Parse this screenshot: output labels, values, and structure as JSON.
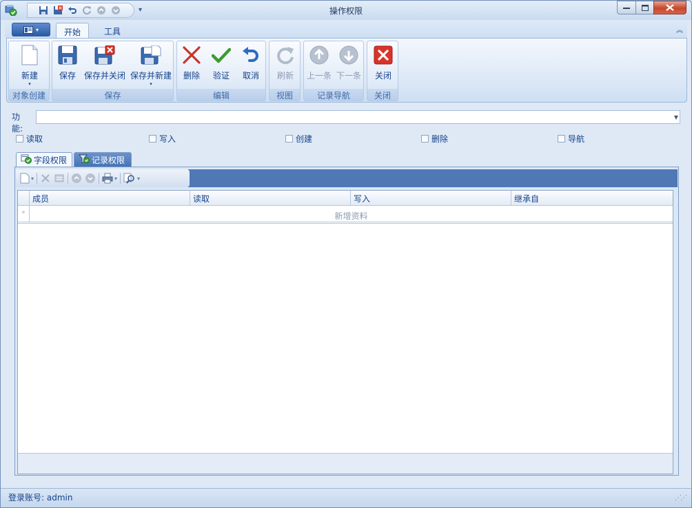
{
  "window": {
    "title": "操作权限"
  },
  "ribbon": {
    "tabs": [
      {
        "label": "开始",
        "active": true
      },
      {
        "label": "工具",
        "active": false
      }
    ],
    "groups": {
      "create": {
        "label": "对象创建",
        "new_label": "新建"
      },
      "save": {
        "label": "保存",
        "save_label": "保存",
        "save_close_label": "保存并关闭",
        "save_new_label": "保存并新建"
      },
      "edit": {
        "label": "编辑",
        "delete_label": "删除",
        "validate_label": "验证",
        "cancel_label": "取消"
      },
      "view": {
        "label": "视图",
        "refresh_label": "刷新"
      },
      "nav": {
        "label": "记录导航",
        "prev_label": "上一条",
        "next_label": "下一条"
      },
      "close": {
        "label": "关闭",
        "close_label": "关闭"
      }
    }
  },
  "form": {
    "function_label": "功能:",
    "function_value": "",
    "checkboxes": [
      {
        "label": "读取",
        "checked": false
      },
      {
        "label": "写入",
        "checked": false
      },
      {
        "label": "创建",
        "checked": false
      },
      {
        "label": "删除",
        "checked": false
      },
      {
        "label": "导航",
        "checked": false
      }
    ]
  },
  "subtabs": [
    {
      "label": "字段权限",
      "active": true
    },
    {
      "label": "记录权限",
      "active": false
    }
  ],
  "grid": {
    "columns": [
      "成员",
      "读取",
      "写入",
      "继承自"
    ],
    "new_row_text": "新增资料",
    "new_row_marker": "*"
  },
  "status": {
    "text": "登录账号: admin"
  },
  "colors": {
    "accent": "#15428b",
    "ribbon_bg": "#dbe7f6",
    "toolbar_strip": "#4f78b5",
    "close_red": "#d9332a"
  }
}
